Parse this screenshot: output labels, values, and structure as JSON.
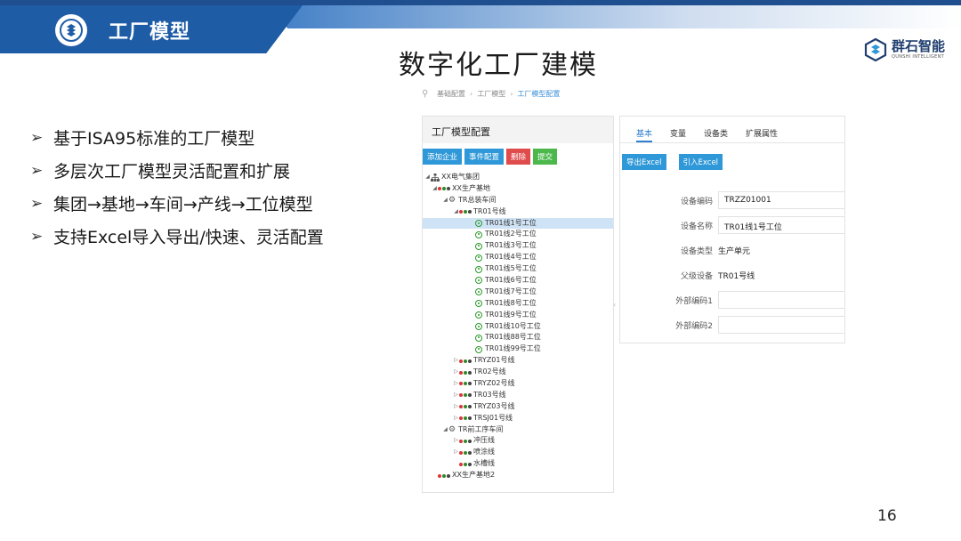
{
  "header": {
    "title": "工厂模型"
  },
  "brand": {
    "name_cn": "群石智能",
    "name_en": "QUNSHI INTELLIGENT"
  },
  "main_title": "数字化工厂建模",
  "bullets": [
    "基于ISA95标准的工厂模型",
    "多层次工厂模型灵活配置和扩展",
    "集团→基地→车间→产线→工位模型",
    "支持Excel导入导出/快速、灵活配置"
  ],
  "page_number": "16",
  "app": {
    "breadcrumb": [
      "基础配置",
      "工厂模型",
      "工厂模型配置"
    ],
    "left_panel": {
      "title": "工厂模型配置",
      "buttons": {
        "add": "添加企业",
        "event": "事件配置",
        "delete": "删除",
        "submit": "提交"
      },
      "tree": [
        {
          "label": "XX电气集团",
          "level": 0,
          "icon": "org-icon",
          "toggle": "expanded"
        },
        {
          "label": "XX生产基地",
          "level": 1,
          "icon": "dots-icon",
          "toggle": "expanded"
        },
        {
          "label": "TR总装车间",
          "level": 2,
          "icon": "gear-icon",
          "toggle": "expanded"
        },
        {
          "label": "TR01号线",
          "level": 3,
          "icon": "dots-icon",
          "toggle": "expanded"
        },
        {
          "label": "TR01线1号工位",
          "level": 4,
          "icon": "station-icon",
          "toggle": "none",
          "selected": true
        },
        {
          "label": "TR01线2号工位",
          "level": 4,
          "icon": "station-icon",
          "toggle": "none"
        },
        {
          "label": "TR01线3号工位",
          "level": 4,
          "icon": "station-icon",
          "toggle": "none"
        },
        {
          "label": "TR01线4号工位",
          "level": 4,
          "icon": "station-icon",
          "toggle": "none"
        },
        {
          "label": "TR01线5号工位",
          "level": 4,
          "icon": "station-icon",
          "toggle": "none"
        },
        {
          "label": "TR01线6号工位",
          "level": 4,
          "icon": "station-icon",
          "toggle": "none"
        },
        {
          "label": "TR01线7号工位",
          "level": 4,
          "icon": "station-icon",
          "toggle": "none"
        },
        {
          "label": "TR01线8号工位",
          "level": 4,
          "icon": "station-icon",
          "toggle": "none"
        },
        {
          "label": "TR01线9号工位",
          "level": 4,
          "icon": "station-icon",
          "toggle": "none"
        },
        {
          "label": "TR01线10号工位",
          "level": 4,
          "icon": "station-icon",
          "toggle": "none"
        },
        {
          "label": "TR01线88号工位",
          "level": 4,
          "icon": "station-icon",
          "toggle": "none"
        },
        {
          "label": "TR01线99号工位",
          "level": 4,
          "icon": "station-icon",
          "toggle": "none"
        },
        {
          "label": "TRYZ01号线",
          "level": 3,
          "icon": "dots-icon",
          "toggle": "collapsed"
        },
        {
          "label": "TR02号线",
          "level": 3,
          "icon": "dots-icon",
          "toggle": "collapsed"
        },
        {
          "label": "TRYZ02号线",
          "level": 3,
          "icon": "dots-icon",
          "toggle": "collapsed"
        },
        {
          "label": "TR03号线",
          "level": 3,
          "icon": "dots-icon",
          "toggle": "collapsed"
        },
        {
          "label": "TRYZ03号线",
          "level": 3,
          "icon": "dots-icon",
          "toggle": "collapsed"
        },
        {
          "label": "TRSJ01号线",
          "level": 3,
          "icon": "dots-icon",
          "toggle": "collapsed"
        },
        {
          "label": "TR前工序车间",
          "level": 2,
          "icon": "gear-icon",
          "toggle": "expanded"
        },
        {
          "label": "冲压线",
          "level": 3,
          "icon": "dots-icon",
          "toggle": "collapsed"
        },
        {
          "label": "喷涂线",
          "level": 3,
          "icon": "dots-icon",
          "toggle": "collapsed"
        },
        {
          "label": "水槽线",
          "level": 3,
          "icon": "dots-icon",
          "toggle": "none"
        },
        {
          "label": "XX生产基地2",
          "level": 1,
          "icon": "dots-icon",
          "toggle": "none"
        }
      ]
    },
    "right_panel": {
      "tabs": [
        "基本",
        "变量",
        "设备类",
        "扩展属性"
      ],
      "active_tab": "基本",
      "buttons": {
        "export": "导出Excel",
        "import": "引入Excel"
      },
      "fields": [
        {
          "label": "设备编码",
          "value": "TRZZ01001",
          "boxed": true
        },
        {
          "label": "设备名称",
          "value": "TR01线1号工位",
          "boxed": true
        },
        {
          "label": "设备类型",
          "value": "生产单元",
          "boxed": false
        },
        {
          "label": "父级设备",
          "value": "TR01号线",
          "boxed": false
        },
        {
          "label": "外部编码1",
          "value": "",
          "boxed": true
        },
        {
          "label": "外部编码2",
          "value": "",
          "boxed": true
        }
      ]
    }
  },
  "colors": {
    "header_blue": "#1f5ca6",
    "accent_blue": "#2f98d8",
    "delete_red": "#e04b4b",
    "submit_green": "#4cb84c",
    "selected_row": "#cfe3f6"
  }
}
